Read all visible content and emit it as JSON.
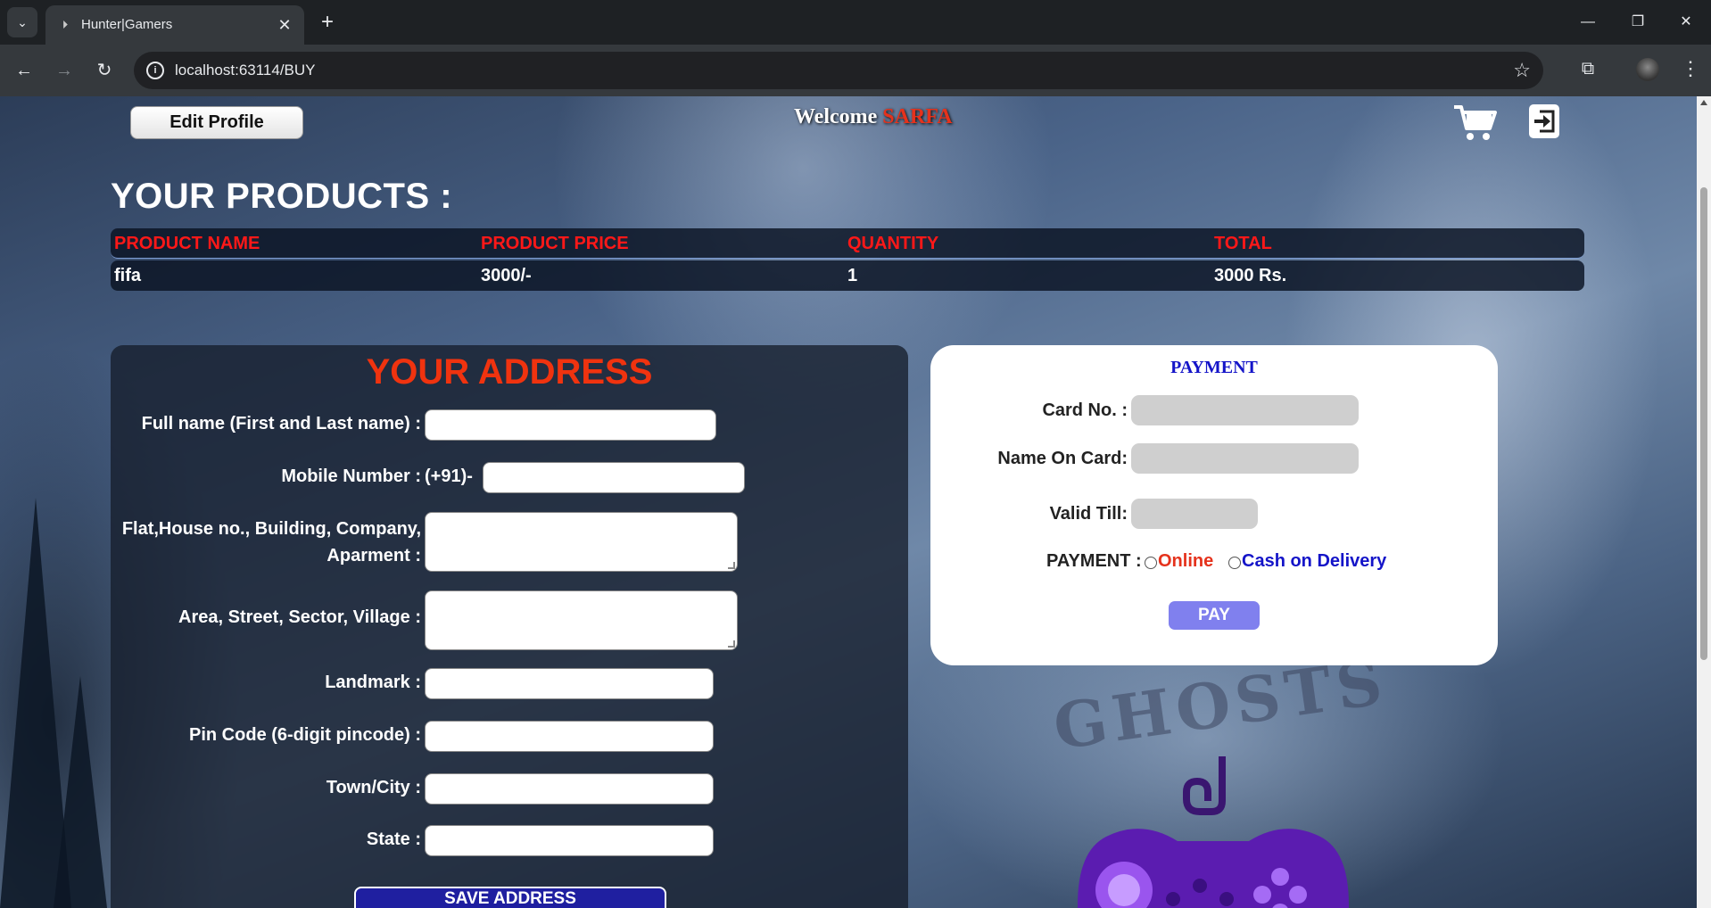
{
  "browser": {
    "tab_title": "Hunter|Gamers",
    "tab_favicon": "playstation-icon",
    "url": "localhost:63114/BUY",
    "icons": {
      "tab_list": "chevron-down-icon",
      "close_tab": "close-icon",
      "new_tab": "plus-icon",
      "back": "back-arrow-icon",
      "forward": "forward-arrow-icon",
      "reload": "reload-icon",
      "site_info": "info-icon",
      "bookmark": "star-icon",
      "extensions": "puzzle-icon",
      "menu": "kebab-menu-icon",
      "minimize": "minimize-icon",
      "restore": "restore-icon",
      "close_window": "close-icon"
    },
    "glyphs": {
      "tab_list": "⌄",
      "favicon": "⏵",
      "close_tab": "✕",
      "new_tab": "+",
      "minimize": "—",
      "restore": "❐",
      "close_window": "✕",
      "back": "←",
      "forward": "→",
      "reload": "↻",
      "info": "i",
      "star": "☆",
      "extensions": "⧉",
      "menu": "⋮"
    }
  },
  "header": {
    "edit_profile": "Edit Profile",
    "welcome_text": "Welcome",
    "username": "SARFA",
    "cart_icon": "shopping-cart-icon",
    "logout_icon": "logout-icon"
  },
  "products": {
    "title": "YOUR PRODUCTS :",
    "columns": [
      "PRODUCT NAME",
      "PRODUCT PRICE",
      "QUANTITY",
      "TOTAL"
    ],
    "rows": [
      {
        "name": "fifa",
        "price": "3000/-",
        "quantity": "1",
        "total": "3000 Rs."
      }
    ]
  },
  "address": {
    "title": "YOUR ADDRESS",
    "full_name_label": "Full name (First and Last name) :",
    "mobile_label": "Mobile Number :",
    "mobile_prefix": "(+91)-",
    "flat_label_line1": "Flat,House no., Building, Company,",
    "flat_label_line2": "Aparment :",
    "area_label": "Area, Street, Sector, Village :",
    "landmark_label": "Landmark :",
    "pincode_label": "Pin Code (6-digit pincode) :",
    "city_label": "Town/City :",
    "state_label": "State :",
    "save_button": "SAVE ADDRESS"
  },
  "payment": {
    "title": "PAYMENT",
    "card_no_label": "Card No. :",
    "name_on_card_label": "Name On Card:",
    "valid_till_label": "Valid Till:",
    "method_label": "PAYMENT :",
    "option_online": "Online",
    "option_cod": "Cash on Delivery",
    "pay_button": "PAY"
  },
  "background": {
    "artwork_text": "GHOSTS"
  },
  "colors": {
    "accent_red": "#f0330f",
    "table_header_red": "#ff1818",
    "payment_blue": "#1414c8",
    "pay_button": "#8080ee",
    "save_button": "#1f1fa0"
  }
}
